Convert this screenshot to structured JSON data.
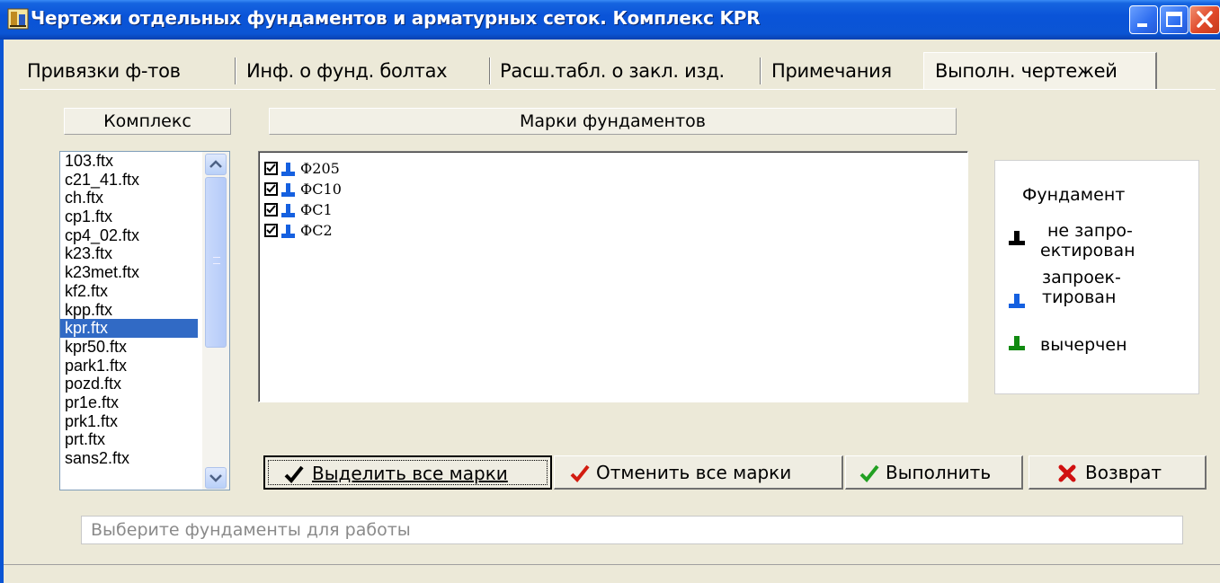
{
  "window": {
    "title": "Чертежи отдельных фундаментов и арматурных сеток. Комплекс KPR"
  },
  "tabs": [
    {
      "label": "Привязки ф-тов"
    },
    {
      "label": "Инф. о фунд. болтах"
    },
    {
      "label": "Расш.табл. о закл. изд."
    },
    {
      "label": "Примечания"
    },
    {
      "label": "Выполн. чертежей",
      "active": true
    }
  ],
  "complex": {
    "header": "Комплекс",
    "items": [
      "103.ftx",
      "c21_41.ftx",
      "ch.ftx",
      "cp1.ftx",
      "cp4_02.ftx",
      "k23.ftx",
      "k23met.ftx",
      "kf2.ftx",
      "kpp.ftx",
      "kpr.ftx",
      "kpr50.ftx",
      "park1.ftx",
      "pozd.ftx",
      "pr1e.ftx",
      "prk1.ftx",
      "prt.ftx",
      "sans2.ftx"
    ],
    "selected": "kpr.ftx"
  },
  "marks": {
    "header": "Марки фундаментов",
    "items": [
      {
        "label": "Ф205",
        "checked": true
      },
      {
        "label": "ФС10",
        "checked": true
      },
      {
        "label": "ФС1",
        "checked": true
      },
      {
        "label": "ФС2",
        "checked": true
      }
    ]
  },
  "legend": {
    "title": "Фундамент",
    "not_designed_line1": "не запро-",
    "not_designed_line2": "ектирован",
    "designed_line1": "запроек-",
    "designed_line2": "тирован",
    "drawn": "вычерчен",
    "colors": {
      "not_designed": "#000000",
      "designed": "#1560e0",
      "drawn": "#118a11"
    }
  },
  "buttons": {
    "select_all": "Выделить все марки",
    "deselect_all": "Отменить все марки",
    "execute": "Выполнить",
    "back": "Возврат"
  },
  "status": {
    "placeholder": "Выберите фундаменты для работы"
  },
  "icons": {
    "app": "drawing-app-icon",
    "foundation": "foundation-icon",
    "check": "checkmark-icon",
    "close": "red-x-icon"
  }
}
